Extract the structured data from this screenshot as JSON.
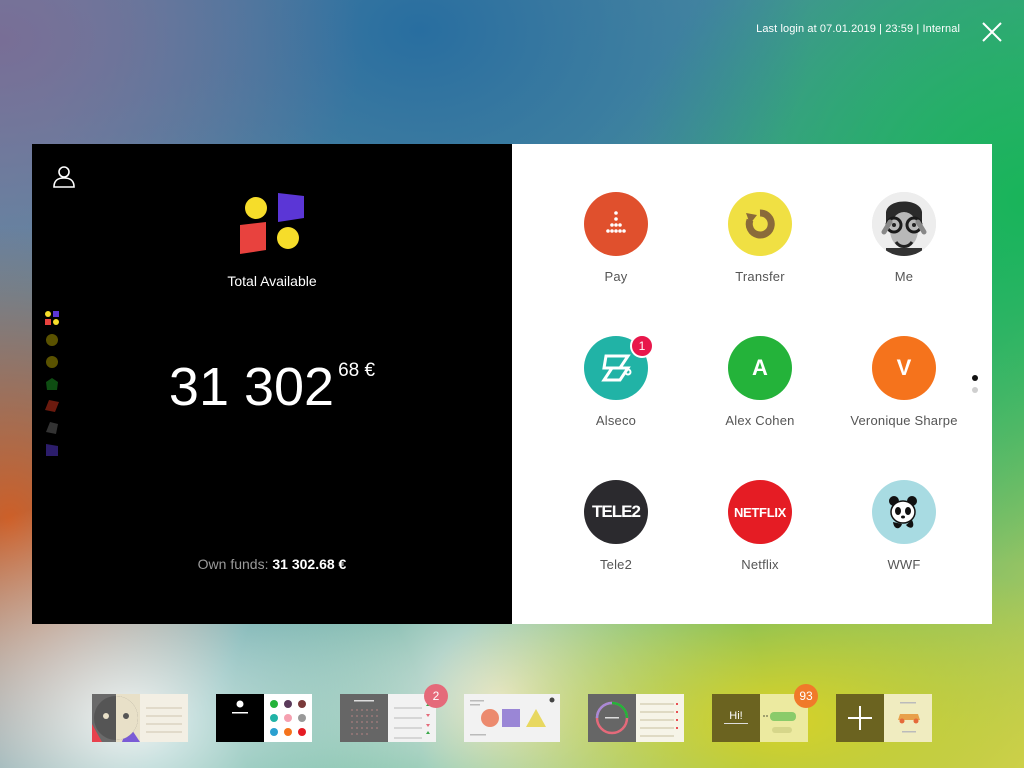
{
  "topbar": {
    "last_login": "Last login at 07.01.2019 | 23:59 | Internal"
  },
  "wallet": {
    "total_label": "Total Available",
    "balance_main": "31 302",
    "balance_decimal": "68 €",
    "own_funds_label": "Own funds:",
    "own_funds_value": "31 302.68 €"
  },
  "accounts_rail": [
    {
      "icon": "brand-logo-icon"
    },
    {
      "icon": "account-dot-icon",
      "color": "#5a5200"
    },
    {
      "icon": "account-dot-icon",
      "color": "#5a5200"
    },
    {
      "icon": "account-shape-icon",
      "color": "#0e4d12"
    },
    {
      "icon": "account-shape-icon",
      "color": "#6b1a0e"
    },
    {
      "icon": "account-shape-icon",
      "color": "#333333"
    },
    {
      "icon": "account-shape-icon",
      "color": "#2c1d6b"
    }
  ],
  "tiles": [
    {
      "label": "Pay",
      "icon": "pay-dots-icon",
      "color": "#e0502d"
    },
    {
      "label": "Transfer",
      "icon": "transfer-arrow-icon",
      "color": "#f0e043"
    },
    {
      "label": "Me",
      "icon": "avatar-photo-icon",
      "color": "#e8e8e8"
    },
    {
      "label": "Alseco",
      "icon": "alseco-logo-icon",
      "color": "#21b3a6",
      "badge": "1"
    },
    {
      "label": "Alex Cohen",
      "letter": "A",
      "color": "#24b33a"
    },
    {
      "label": "Veronique Sharpe",
      "letter": "V",
      "color": "#f5731c"
    },
    {
      "label": "Tele2",
      "icon": "tele2-logo-icon",
      "logo_text": "TELE2",
      "color": "#2b2a2e"
    },
    {
      "label": "Netflix",
      "icon": "netflix-logo-icon",
      "logo_text": "NETFLIX",
      "color": "#e51c24"
    },
    {
      "label": "WWF",
      "icon": "panda-icon",
      "color": "#a8dbe2"
    }
  ],
  "pager": {
    "pages": 2,
    "active": 1
  },
  "dock": [
    {
      "name": "dock-app-faces"
    },
    {
      "name": "dock-app-wallet"
    },
    {
      "name": "dock-app-calendar",
      "badge": "2",
      "badge_color": "#e56a7a"
    },
    {
      "name": "dock-app-shapes"
    },
    {
      "name": "dock-app-gauge"
    },
    {
      "name": "dock-app-chat",
      "badge": "93",
      "badge_color": "#f07a2a",
      "hi": "Hi!"
    },
    {
      "name": "dock-app-add"
    }
  ],
  "colors": {
    "brand_yellow": "#f6dd2a",
    "brand_purple": "#5b36d6",
    "brand_red": "#e8423e"
  }
}
